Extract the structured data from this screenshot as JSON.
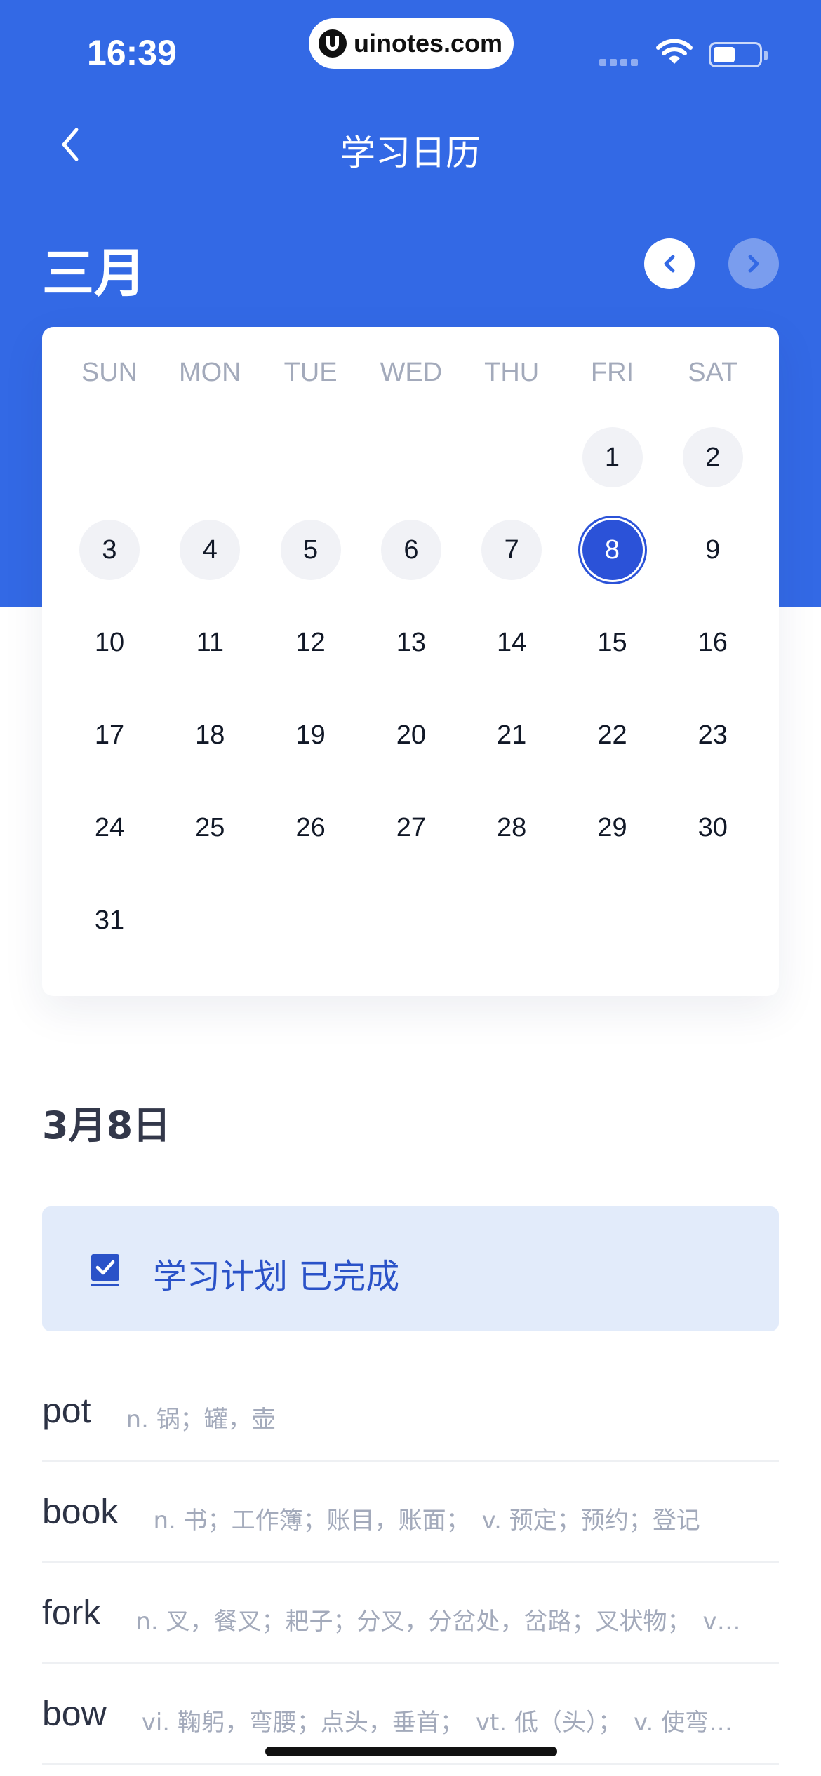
{
  "status_bar": {
    "time": "16:39",
    "watermark": "uinotes.com"
  },
  "nav": {
    "title": "学习日历",
    "back_icon": "chevron-left-icon"
  },
  "calendar": {
    "month": "三月",
    "prev_icon": "chevron-left-icon",
    "next_icon": "chevron-right-icon",
    "weekdays": [
      "SUN",
      "MON",
      "TUE",
      "WED",
      "THU",
      "FRI",
      "SAT"
    ],
    "days": [
      "1",
      "2",
      "3",
      "4",
      "5",
      "6",
      "7",
      "8",
      "9",
      "10",
      "11",
      "12",
      "13",
      "14",
      "15",
      "16",
      "17",
      "18",
      "19",
      "20",
      "21",
      "22",
      "23",
      "24",
      "25",
      "26",
      "27",
      "28",
      "29",
      "30",
      "31"
    ],
    "studied_days": [
      "1",
      "2",
      "3",
      "4",
      "5",
      "6",
      "7"
    ],
    "selected_day": "8"
  },
  "date_section": {
    "date": "3月8日",
    "plan_status": "学习计划 已完成"
  },
  "words": [
    {
      "word": "pot",
      "definition": "n. 锅；罐，壶"
    },
    {
      "word": "book",
      "definition": "n. 书；工作簿；账目，账面；　v. 预定；预约；登记"
    },
    {
      "word": "fork",
      "definition": "n. 叉，餐叉；耙子；分叉，分岔处，岔路；叉状物；　v…"
    },
    {
      "word": "bow",
      "definition": "vi. 鞠躬，弯腰；点头，垂首；　vt. 低（头）；　v. 使弯…"
    }
  ],
  "colors": {
    "header_blue": "#3369E5",
    "selected_blue": "#2B52D8",
    "studied_bg": "#F1F2F6",
    "plan_bg": "#E2EBFA"
  }
}
